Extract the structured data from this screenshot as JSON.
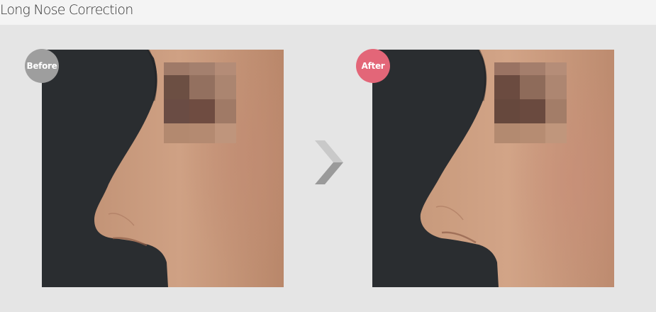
{
  "header": {
    "title": "Long Nose Correction"
  },
  "comparison": {
    "before": {
      "badge_label": "Before",
      "badge_color": "#9e9e9e",
      "photo_subject": "side profile, long nose, eyes pixelated"
    },
    "after": {
      "badge_label": "After",
      "badge_color": "#e36678",
      "photo_subject": "side profile, corrected nose, eyes pixelated"
    },
    "separator_icon": "chevron-right-icon"
  }
}
